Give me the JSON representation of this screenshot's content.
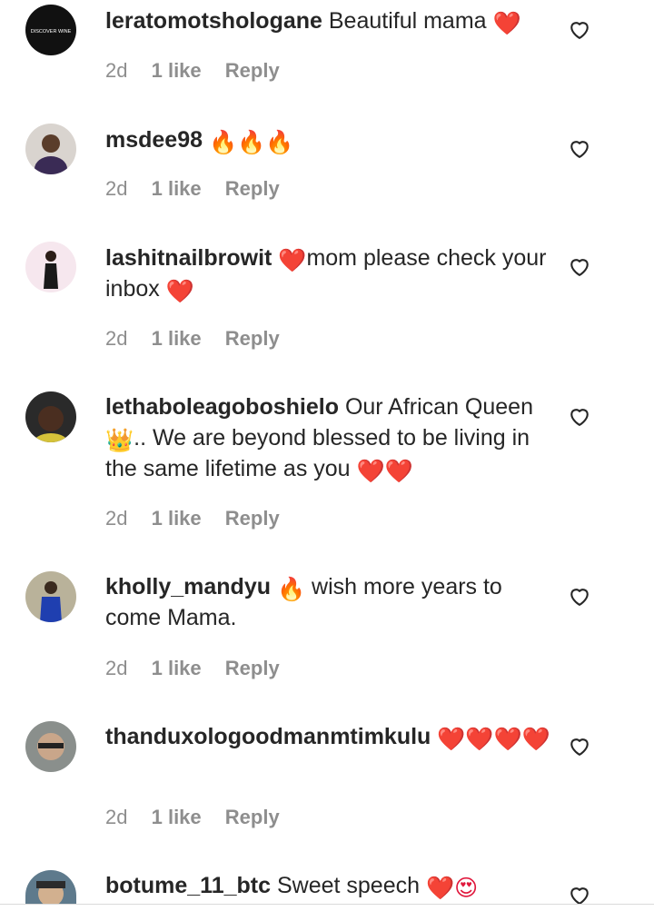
{
  "comments": [
    {
      "username": "leratomotshologane",
      "text": "Beautiful mama",
      "emoji": "❤️",
      "time": "2d",
      "likes": "1 like",
      "reply": "Reply",
      "avatar_label": "DISCOVER WINE"
    },
    {
      "username": "msdee98",
      "text": "",
      "emoji": "🔥🔥🔥",
      "time": "2d",
      "likes": "1 like",
      "reply": "Reply"
    },
    {
      "username": "lashitnailbrowit",
      "emoji_pre": "❤️",
      "text": "mom please check your inbox",
      "emoji": "❤️",
      "time": "2d",
      "likes": "1 like",
      "reply": "Reply"
    },
    {
      "username": "lethaboleagoboshielo",
      "text": "Our African Queen",
      "emoji_mid": "👑",
      "text2": ".. We are beyond blessed to be living in the same lifetime as you",
      "emoji": "❤️❤️",
      "time": "2d",
      "likes": "1 like",
      "reply": "Reply"
    },
    {
      "username": "kholly_mandyu",
      "emoji_pre": "🔥",
      "text": "wish more years to come Mama.",
      "time": "2d",
      "likes": "1 like",
      "reply": "Reply"
    },
    {
      "username": "thanduxologoodmanmtimkulu",
      "emoji": "❤️❤️❤️❤️",
      "time": "2d",
      "likes": "1 like",
      "reply": "Reply"
    },
    {
      "username": "botume_11_btc",
      "text": "Sweet speech",
      "emoji": "❤️😍"
    }
  ],
  "colors": {
    "text": "#262626",
    "meta": "#8e8e8e",
    "heart": "#e0173c"
  },
  "icons": {
    "like": "heart-outline-icon"
  }
}
